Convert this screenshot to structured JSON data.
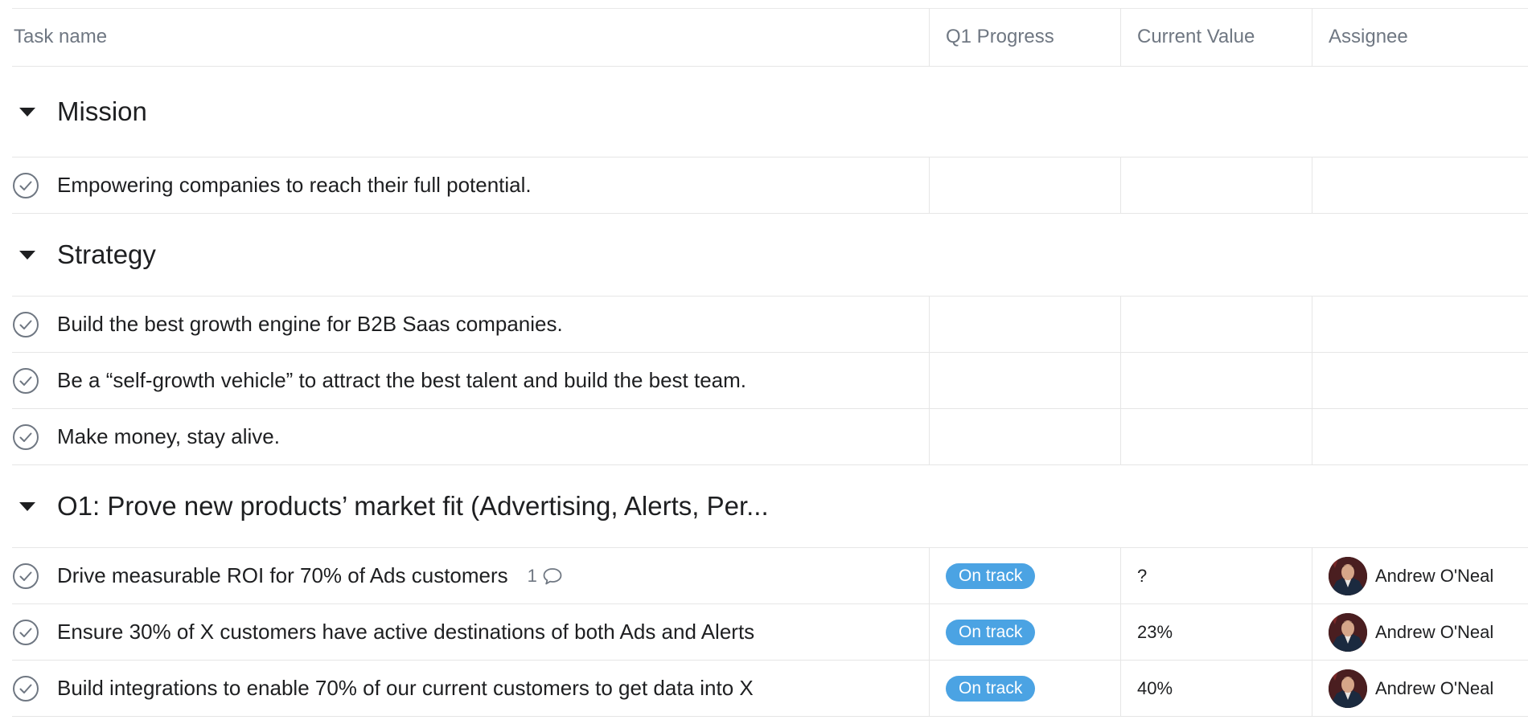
{
  "columns": {
    "task_name": "Task name",
    "progress": "Q1 Progress",
    "value": "Current Value",
    "assignee": "Assignee"
  },
  "sections": [
    {
      "title": "Mission",
      "tasks": [
        {
          "name": "Empowering companies to reach their full potential.",
          "comments": "",
          "progress": "",
          "value": "",
          "assignee": ""
        }
      ]
    },
    {
      "title": "Strategy",
      "tasks": [
        {
          "name": "Build the best growth engine for B2B Saas companies.",
          "comments": "",
          "progress": "",
          "value": "",
          "assignee": ""
        },
        {
          "name": "Be a “self-growth vehicle” to attract the best talent and build the best team.",
          "comments": "",
          "progress": "",
          "value": "",
          "assignee": ""
        },
        {
          "name": "Make money, stay alive.",
          "comments": "",
          "progress": "",
          "value": "",
          "assignee": ""
        }
      ]
    },
    {
      "title": "O1: Prove new products’ market fit (Advertising, Alerts, Per...",
      "tasks": [
        {
          "name": "Drive measurable ROI for 70% of Ads customers",
          "comments": "1",
          "progress": "On track",
          "value": "?",
          "assignee": "Andrew O'Neal"
        },
        {
          "name": "Ensure 30% of X customers have active destinations of both Ads and Alerts",
          "comments": "",
          "progress": "On track",
          "value": "23%",
          "assignee": "Andrew O'Neal"
        },
        {
          "name": "Build integrations to enable 70% of our current customers to get data into X",
          "comments": "",
          "progress": "On track",
          "value": "40%",
          "assignee": "Andrew O'Neal"
        }
      ]
    }
  ],
  "colors": {
    "badge_on_track": "#4ba3e3",
    "border": "#e6e6e6",
    "muted_text": "#6f7782"
  },
  "icons": {
    "section_toggle": "caret-down-icon",
    "task_complete": "check-circle-icon",
    "comment": "comment-bubble-icon"
  }
}
